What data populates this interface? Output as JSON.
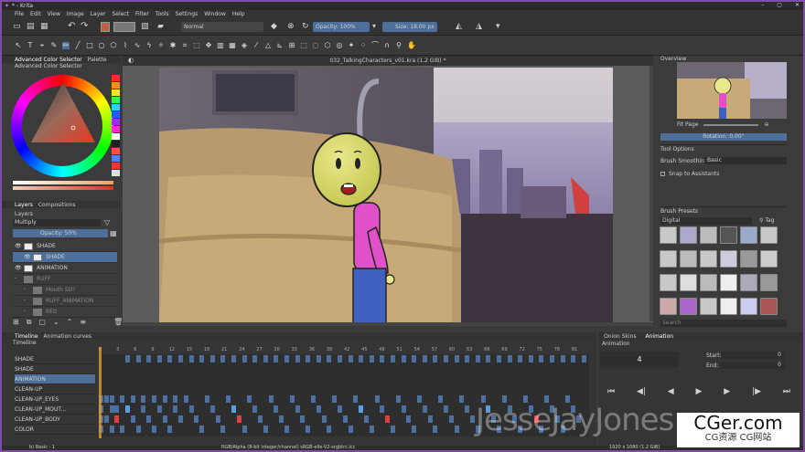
{
  "app": {
    "title": "* - Krita",
    "window_controls": [
      "–",
      "▢",
      "✕"
    ]
  },
  "menu": [
    "File",
    "Edit",
    "View",
    "Image",
    "Layer",
    "Select",
    "Filter",
    "Tools",
    "Settings",
    "Window",
    "Help"
  ],
  "toolbar": {
    "blend_mode": "Normal",
    "opacity": "Opacity: 100%",
    "size": "Size: 18.00 px"
  },
  "docker_left": {
    "tabs": [
      "Advanced Color Selector",
      "Palette"
    ],
    "panel_title": "Advanced Color Selector",
    "layers_tabs": [
      "Layers",
      "Compositions"
    ],
    "layers_label": "Layers",
    "blend": "Multiply",
    "opacity": "Opacity: 50%",
    "layers": [
      {
        "name": "SHADE",
        "indent": 0
      },
      {
        "name": "SHADE",
        "indent": 1
      },
      {
        "name": "ANIMATION",
        "indent": 0
      },
      {
        "name": "RUFF",
        "indent": 0
      },
      {
        "name": "Mouth SD?",
        "indent": 1
      },
      {
        "name": "RUFF_ANIMATION",
        "indent": 1
      },
      {
        "name": "RED",
        "indent": 1
      }
    ],
    "swatches": [
      "#ff2a2a",
      "#ff8a2a",
      "#ffe02a",
      "#2aff5a",
      "#2ad0ff",
      "#2a5aff",
      "#a02aff",
      "#ff2ad0",
      "#ffffff",
      "#202020",
      "#ff5050",
      "#5080ff",
      "#ff3030",
      "#e0e0e0"
    ]
  },
  "canvas": {
    "doc_title": "032_TalkingCharacters_v01.kra (1.2 GiB) *"
  },
  "docker_right": {
    "overview_title": "Overview",
    "fit_page": "Fit Page",
    "rotation": "Rotation: 0.00°",
    "tool_options_title": "Tool Options",
    "smoothing_label": "Brush Smoothing:",
    "smoothing_value": "Basic",
    "snap_label": "Snap to Assistants",
    "presets_title": "Brush Presets",
    "presets_filter": "Digital",
    "tag_label": "Tag",
    "search_label": "Search"
  },
  "timeline": {
    "tabs": [
      "Timeline",
      "Animation curves"
    ],
    "header": "Timeline",
    "frame_numbers": [
      "0",
      "3",
      "6",
      "9",
      "12",
      "15",
      "18",
      "21",
      "24",
      "27",
      "30",
      "33",
      "36",
      "39",
      "42",
      "45",
      "48",
      "51",
      "54",
      "57",
      "60",
      "63",
      "66",
      "69",
      "72",
      "75",
      "78",
      "81"
    ],
    "rows": [
      "SHADE",
      "SHADE",
      "ANIMATION",
      "CLEAN-UP",
      "CLEAN-UP_EYES",
      "CLEAN-UP_MOUT...",
      "CLEAN-UP_BODY",
      "COLOR"
    ]
  },
  "animation": {
    "tabs": [
      "Onion Skins",
      "Animation"
    ],
    "header": "Animation",
    "current_frame": "4",
    "start_label": "Start:",
    "end_label": "End:",
    "start_value": "0",
    "end_value": "0"
  },
  "status": {
    "left": "b) Basic - 1",
    "center": "RGB/Alpha (8-bit integer/channel)  sRGB-elle-V2-srgbtrc.icc",
    "right": "1920 x 1080 (1.2 GiB)"
  },
  "watermark": "JesseJayJones",
  "badge": {
    "main": "CGer.com",
    "sub": "CG资源 CG网站"
  },
  "colors": {
    "accent": "#7d4ea3",
    "keyframe": "#4d6fa0",
    "keyframe_red": "#e04040",
    "keyframe_light": "#5aa0e0"
  }
}
